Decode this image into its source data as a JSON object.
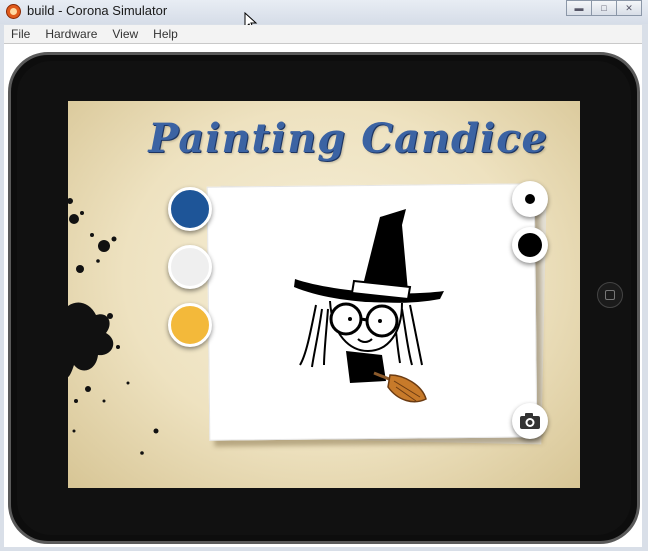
{
  "window": {
    "title": "build - Corona Simulator",
    "buttons": [
      "minimize",
      "maximize",
      "close"
    ]
  },
  "menubar": {
    "items": [
      "File",
      "Hardware",
      "View",
      "Help"
    ]
  },
  "app": {
    "title": "Painting Candice",
    "colors": [
      {
        "name": "blue",
        "hex": "#1e5598"
      },
      {
        "name": "white",
        "hex": "#efefef"
      },
      {
        "name": "yellow",
        "hex": "#f3b93a"
      }
    ],
    "brush_sizes": [
      "small-brush",
      "large-brush"
    ],
    "camera_icon": "camera-icon"
  }
}
